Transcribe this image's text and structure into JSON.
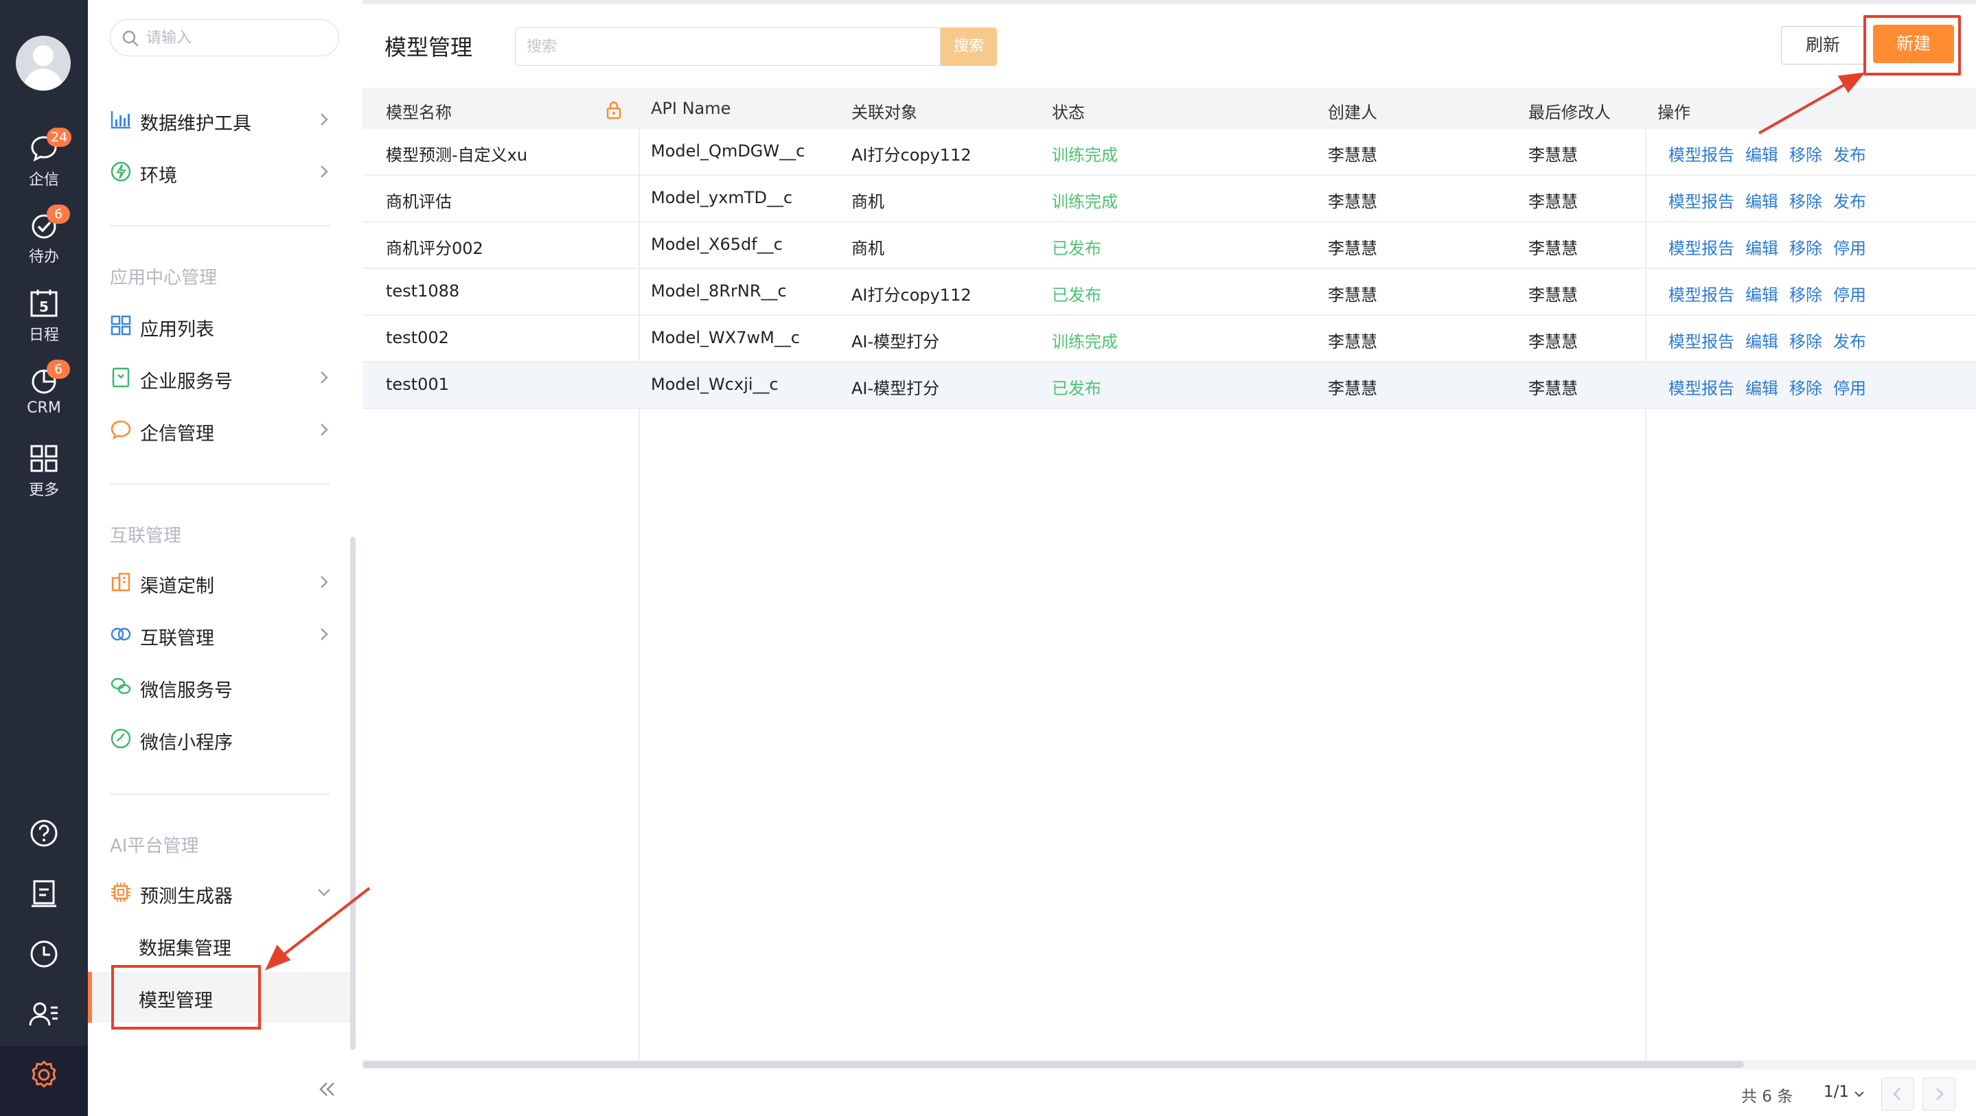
{
  "rail": {
    "items": [
      {
        "label": "企信",
        "badge": "24"
      },
      {
        "label": "待办",
        "badge": "6"
      },
      {
        "label": "日程",
        "day": "5"
      },
      {
        "label": "CRM",
        "badge": "6"
      },
      {
        "label": "更多"
      }
    ],
    "tools": [
      "help-icon",
      "notebook-icon",
      "clock-icon",
      "contacts-icon",
      "settings-icon"
    ],
    "accent": "#ff7a45"
  },
  "sidebar": {
    "search_placeholder": "请输入",
    "top_items": [
      {
        "label": "数据维护工具",
        "icon": "bar-chart-icon"
      },
      {
        "label": "环境",
        "icon": "environment-icon"
      }
    ],
    "sections": [
      {
        "title": "应用中心管理",
        "items": [
          {
            "label": "应用列表",
            "icon": "grid-icon"
          },
          {
            "label": "企业服务号",
            "icon": "service-icon"
          },
          {
            "label": "企信管理",
            "icon": "chat-icon"
          }
        ]
      },
      {
        "title": "互联管理",
        "items": [
          {
            "label": "渠道定制",
            "icon": "building-icon"
          },
          {
            "label": "互联管理",
            "icon": "link-icon"
          },
          {
            "label": "微信服务号",
            "icon": "wechat-icon"
          },
          {
            "label": "微信小程序",
            "icon": "miniprogram-icon"
          }
        ]
      },
      {
        "title": "AI平台管理",
        "items": [
          {
            "label": "预测生成器",
            "icon": "chip-icon",
            "children": [
              "数据集管理",
              "模型管理"
            ]
          }
        ]
      }
    ],
    "active": "模型管理"
  },
  "main": {
    "title": "模型管理",
    "search_placeholder": "搜索",
    "search_button": "搜索",
    "refresh_button": "刷新",
    "new_button": "新建",
    "columns": [
      "模型名称",
      "API Name",
      "关联对象",
      "状态",
      "创建人",
      "最后修改人",
      "操作"
    ],
    "rows": [
      {
        "name": "模型预测-自定义xu",
        "api": "Model_QmDGW__c",
        "object": "AI打分copy112",
        "status": "训练完成",
        "creator": "李慧慧",
        "modifier": "李慧慧",
        "ops": [
          "模型报告",
          "编辑",
          "移除",
          "发布"
        ]
      },
      {
        "name": "商机评估",
        "api": "Model_yxmTD__c",
        "object": "商机",
        "status": "训练完成",
        "creator": "李慧慧",
        "modifier": "李慧慧",
        "ops": [
          "模型报告",
          "编辑",
          "移除",
          "发布"
        ]
      },
      {
        "name": "商机评分002",
        "api": "Model_X65df__c",
        "object": "商机",
        "status": "已发布",
        "creator": "李慧慧",
        "modifier": "李慧慧",
        "ops": [
          "模型报告",
          "编辑",
          "移除",
          "停用"
        ]
      },
      {
        "name": "test1088",
        "api": "Model_8RrNR__c",
        "object": "AI打分copy112",
        "status": "已发布",
        "creator": "李慧慧",
        "modifier": "李慧慧",
        "ops": [
          "模型报告",
          "编辑",
          "移除",
          "停用"
        ]
      },
      {
        "name": "test002",
        "api": "Model_WX7wM__c",
        "object": "AI-模型打分",
        "status": "训练完成",
        "creator": "李慧慧",
        "modifier": "李慧慧",
        "ops": [
          "模型报告",
          "编辑",
          "移除",
          "发布"
        ]
      },
      {
        "name": "test001",
        "api": "Model_Wcxji__c",
        "object": "AI-模型打分",
        "status": "已发布",
        "creator": "李慧慧",
        "modifier": "李慧慧",
        "ops": [
          "模型报告",
          "编辑",
          "移除",
          "停用"
        ]
      }
    ],
    "footer": {
      "total": "共 6 条",
      "page": "1/1"
    },
    "colors": {
      "status": "#4cc46f",
      "link": "#2b7bd6",
      "primary": "#ff8b33",
      "annotation": "#e5402c"
    }
  }
}
